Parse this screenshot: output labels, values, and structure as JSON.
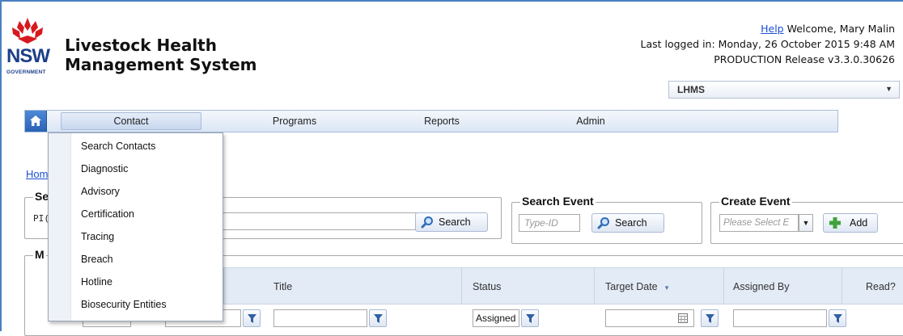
{
  "header": {
    "logo_text": "NSW",
    "logo_subtext": "GOVERNMENT",
    "app_title_line1": "Livestock Health",
    "app_title_line2": "Management System",
    "help_link": "Help",
    "welcome": "Welcome, Mary Malin",
    "last_logged": "Last logged in: Monday, 26 October 2015 9:48 AM",
    "release": "PRODUCTION Release v3.3.0.30626",
    "app_select_value": "LHMS"
  },
  "nav": {
    "items": [
      "Contact",
      "Programs",
      "Reports",
      "Admin"
    ]
  },
  "menu": {
    "items": [
      "Search Contacts",
      "Diagnostic",
      "Advisory",
      "Certification",
      "Tracing",
      "Breach",
      "Hotline",
      "Biosecurity Entities"
    ]
  },
  "breadcrumb": "Hom",
  "search_contact": {
    "legend_partial": "Se",
    "label_partial": "PI(",
    "search_label": "Search"
  },
  "search_event": {
    "legend": "Search Event",
    "placeholder": "Type-ID",
    "search_label": "Search"
  },
  "create_event": {
    "legend": "Create Event",
    "placeholder": "Please Select E",
    "add_label": "Add"
  },
  "grid": {
    "legend_partial": "M",
    "columns": [
      "Title",
      "Status",
      "Target Date",
      "Assigned By",
      "Read?"
    ],
    "status_filter_value": "Assigned"
  },
  "colors": {
    "accent": "#1d3f8a",
    "link": "#1a4fd6",
    "nav_bg": "#dbe6f5"
  }
}
